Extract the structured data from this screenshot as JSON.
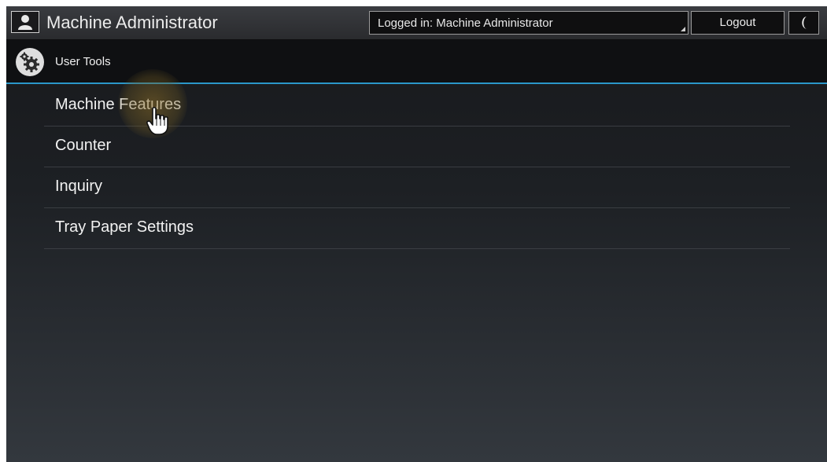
{
  "header": {
    "title": "Machine Administrator",
    "login_status": "Logged in: Machine Administrator",
    "logout_label": "Logout"
  },
  "subheader": {
    "title": "User Tools"
  },
  "menu": {
    "items": [
      {
        "label": "Machine Features"
      },
      {
        "label": "Counter"
      },
      {
        "label": "Inquiry"
      },
      {
        "label": "Tray Paper Settings"
      }
    ]
  },
  "icons": {
    "user": "user-icon",
    "gear": "gear-icon",
    "moon": "moon-icon",
    "cursor": "hand-pointer-icon"
  },
  "colors": {
    "accent": "#2a97c9",
    "highlight": "#8c6e28"
  }
}
